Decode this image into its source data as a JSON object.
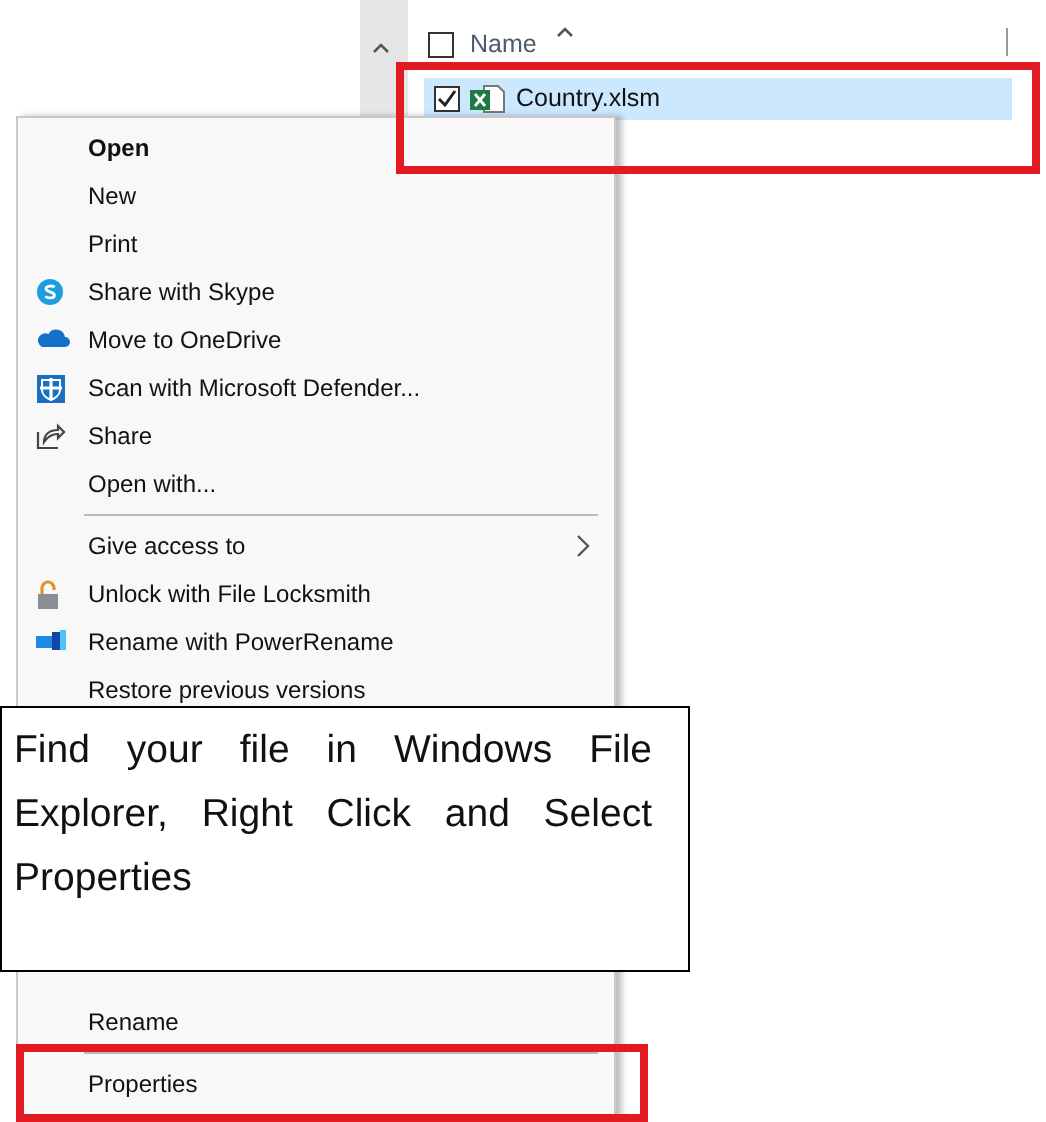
{
  "explorer": {
    "header": {
      "label": "Name",
      "checked": false
    },
    "files": [
      {
        "name": "Country.xlsm",
        "checked": true,
        "selected": true
      }
    ]
  },
  "context_menu": {
    "sections": [
      [
        {
          "label": "Open",
          "kind": "plain",
          "default": true
        },
        {
          "label": "New",
          "kind": "plain",
          "default": false
        },
        {
          "label": "Print",
          "kind": "plain",
          "default": false
        },
        {
          "label": "Share with Skype",
          "kind": "skype",
          "default": false
        },
        {
          "label": "Move to OneDrive",
          "kind": "onedrive",
          "default": false
        },
        {
          "label": "Scan with Microsoft Defender...",
          "kind": "defender",
          "default": false
        },
        {
          "label": "Share",
          "kind": "share",
          "default": false
        },
        {
          "label": "Open with...",
          "kind": "plain",
          "default": false
        },
        {
          "kind": "separator"
        },
        {
          "label": "Give access to",
          "kind": "submenu",
          "default": false
        },
        {
          "label": "Unlock with File Locksmith",
          "kind": "lock",
          "default": false
        },
        {
          "label": "Rename with PowerRename",
          "kind": "rename",
          "default": false
        },
        {
          "label": "Restore previous versions",
          "kind": "plain",
          "default": false
        }
      ],
      [
        {
          "label": "Rename",
          "kind": "plain",
          "default": false
        },
        {
          "kind": "separator"
        },
        {
          "label": "Properties",
          "kind": "plain",
          "default": false
        }
      ]
    ]
  },
  "callout": {
    "text": "Find your file in Windows File Explorer, Right Click and Select Properties"
  }
}
